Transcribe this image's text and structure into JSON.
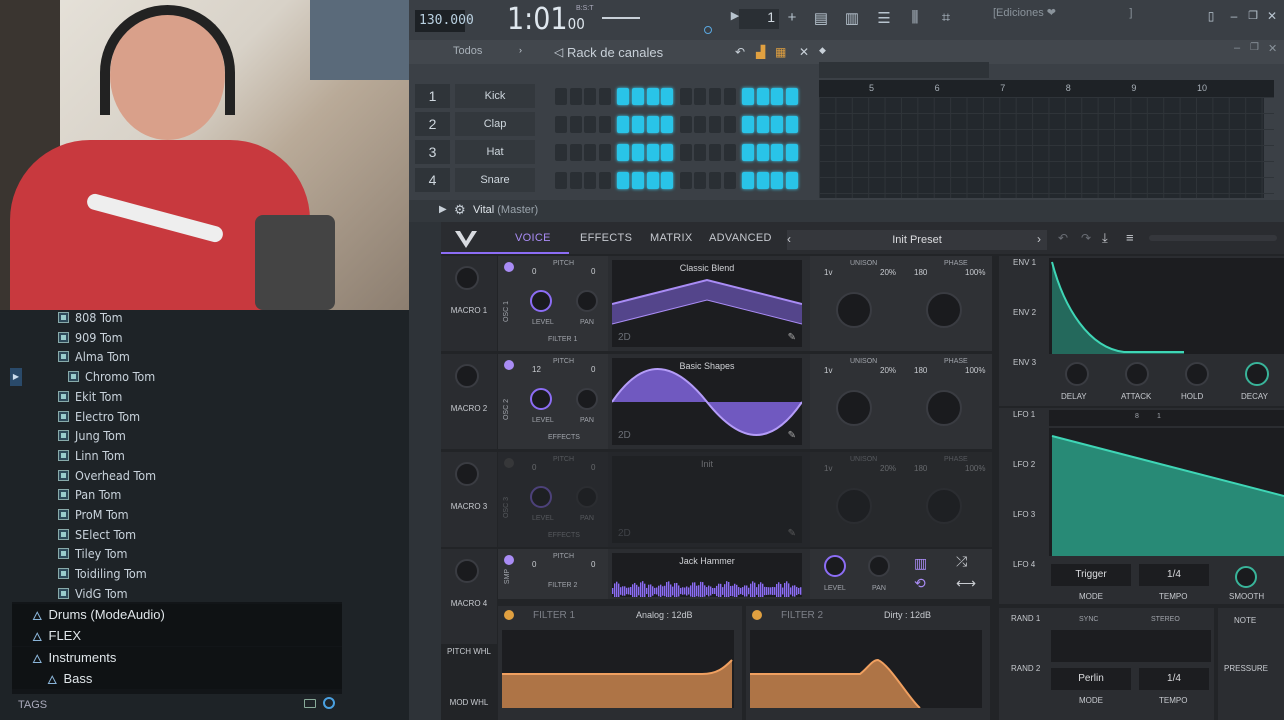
{
  "browser": {
    "items": [
      "808 Tom",
      "909 Tom",
      "Alma Tom",
      "Chromo Tom",
      "Ekit Tom",
      "Electro Tom",
      "Jung Tom",
      "Linn Tom",
      "Overhead Tom",
      "Pan Tom",
      "ProM Tom",
      "SElect Tom",
      "Tiley Tom",
      "Toidiling Tom",
      "VidG Tom"
    ],
    "folders": [
      "Drums (ModeAudio)",
      "FLEX",
      "Instruments",
      "Bass"
    ],
    "tags_label": "TAGS"
  },
  "transport": {
    "tempo": "130.000",
    "time": "1:01",
    "time_sub": "00",
    "bst": "B:S:T",
    "pattern": "1",
    "hint": "[Ediciones ❤",
    "hint_end": "]"
  },
  "rack": {
    "filter": "Todos",
    "title": "Rack de canales",
    "channels": [
      {
        "num": "1",
        "name": "Kick"
      },
      {
        "num": "2",
        "name": "Clap"
      },
      {
        "num": "3",
        "name": "Hat"
      },
      {
        "num": "4",
        "name": "Snare"
      }
    ],
    "pattern_steps": [
      0,
      0,
      0,
      0,
      1,
      1,
      1,
      1,
      0,
      0,
      0,
      0,
      1,
      1,
      1,
      1
    ],
    "bar_numbers": [
      "5",
      "6",
      "7",
      "8",
      "9",
      "10"
    ]
  },
  "vital": {
    "plugin_name": "Vital",
    "plugin_master": "(Master)",
    "tabs": [
      "VOICE",
      "EFFECTS",
      "MATRIX",
      "ADVANCED"
    ],
    "preset": "Init Preset",
    "macros": [
      "MACRO 1",
      "MACRO 2",
      "MACRO 3",
      "MACRO 4"
    ],
    "osc": [
      {
        "label": "OSC 1",
        "pitch_a": "0",
        "pitch_b": "0",
        "wave": "Classic Blend",
        "dest": "FILTER 1",
        "uni_voices": "1v",
        "uni_pct": "20%",
        "phase": "180",
        "phase_pct": "100%"
      },
      {
        "label": "OSC 2",
        "pitch_a": "12",
        "pitch_b": "0",
        "wave": "Basic Shapes",
        "dest": "EFFECTS",
        "uni_voices": "1v",
        "uni_pct": "20%",
        "phase": "180",
        "phase_pct": "100%"
      },
      {
        "label": "OSC 3",
        "pitch_a": "0",
        "pitch_b": "0",
        "wave": "Init",
        "dest": "EFFECTS",
        "uni_voices": "1v",
        "uni_pct": "20%",
        "phase": "180",
        "phase_pct": "100%"
      }
    ],
    "smp": {
      "label": "SMP",
      "pitch_a": "0",
      "pitch_b": "0",
      "wave": "Jack Hammer",
      "dest": "FILTER 2"
    },
    "labels": {
      "pitch": "PITCH",
      "level": "LEVEL",
      "pan": "PAN",
      "unison": "UNISON",
      "phase": "PHASE",
      "twod": "2D"
    },
    "filters": [
      {
        "name": "FILTER 1",
        "model": "Analog : 12dB"
      },
      {
        "name": "FILTER 2",
        "model": "Dirty : 12dB"
      }
    ],
    "wheels": [
      "PITCH WHL",
      "MOD WHL"
    ],
    "envs": [
      "ENV 1",
      "ENV 2",
      "ENV 3"
    ],
    "env_knobs": [
      "DELAY",
      "ATTACK",
      "HOLD",
      "DECAY"
    ],
    "lfos": [
      "LFO 1",
      "LFO 2",
      "LFO 3",
      "LFO 4"
    ],
    "lfo_grid": [
      "8",
      "1"
    ],
    "lfo_ctrl": {
      "trigger": "Trigger",
      "mode": "MODE",
      "tempo_val": "1/4",
      "tempo": "TEMPO",
      "smooth": "SMOOTH"
    },
    "rand": [
      "RAND 1",
      "RAND 2"
    ],
    "rand_ctrl": {
      "sync": "SYNC",
      "stereo": "STEREO",
      "perlin": "Perlin",
      "mode": "MODE",
      "tempo_val": "1/4",
      "tempo": "TEMPO"
    },
    "right_labels": [
      "NOTE",
      "PRESSURE"
    ]
  },
  "colors": {
    "accent": "#a98cf5",
    "step_on": "#29c4e8",
    "filter_fill": "#c8844e",
    "lfo_fill": "#2a9d86"
  }
}
